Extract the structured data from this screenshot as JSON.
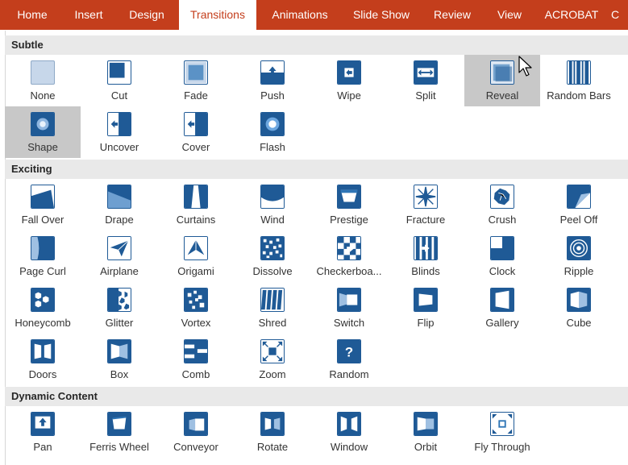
{
  "ribbon": {
    "tabs": [
      {
        "label": "Home"
      },
      {
        "label": "Insert"
      },
      {
        "label": "Design"
      },
      {
        "label": "Transitions"
      },
      {
        "label": "Animations"
      },
      {
        "label": "Slide Show"
      },
      {
        "label": "Review"
      },
      {
        "label": "View"
      },
      {
        "label": "ACROBAT"
      },
      {
        "label": "C"
      }
    ],
    "active_tab": "Transitions"
  },
  "gallery": {
    "sections": [
      {
        "title": "Subtle",
        "items": [
          {
            "label": "None",
            "icon": "none-transition-icon"
          },
          {
            "label": "Cut",
            "icon": "cut-transition-icon"
          },
          {
            "label": "Fade",
            "icon": "fade-transition-icon"
          },
          {
            "label": "Push",
            "icon": "push-transition-icon"
          },
          {
            "label": "Wipe",
            "icon": "wipe-transition-icon"
          },
          {
            "label": "Split",
            "icon": "split-transition-icon"
          },
          {
            "label": "Reveal",
            "icon": "reveal-transition-icon",
            "selected": true
          },
          {
            "label": "Random Bars",
            "icon": "random-bars-transition-icon"
          },
          {
            "label": "Shape",
            "icon": "shape-transition-icon",
            "selected": true
          },
          {
            "label": "Uncover",
            "icon": "uncover-transition-icon"
          },
          {
            "label": "Cover",
            "icon": "cover-transition-icon"
          },
          {
            "label": "Flash",
            "icon": "flash-transition-icon"
          }
        ]
      },
      {
        "title": "Exciting",
        "items": [
          {
            "label": "Fall Over",
            "icon": "fall-over-transition-icon"
          },
          {
            "label": "Drape",
            "icon": "drape-transition-icon"
          },
          {
            "label": "Curtains",
            "icon": "curtains-transition-icon"
          },
          {
            "label": "Wind",
            "icon": "wind-transition-icon"
          },
          {
            "label": "Prestige",
            "icon": "prestige-transition-icon"
          },
          {
            "label": "Fracture",
            "icon": "fracture-transition-icon"
          },
          {
            "label": "Crush",
            "icon": "crush-transition-icon"
          },
          {
            "label": "Peel Off",
            "icon": "peel-off-transition-icon"
          },
          {
            "label": "Page Curl",
            "icon": "page-curl-transition-icon"
          },
          {
            "label": "Airplane",
            "icon": "airplane-transition-icon"
          },
          {
            "label": "Origami",
            "icon": "origami-transition-icon"
          },
          {
            "label": "Dissolve",
            "icon": "dissolve-transition-icon"
          },
          {
            "label": "Checkerboa...",
            "icon": "checkerboard-transition-icon"
          },
          {
            "label": "Blinds",
            "icon": "blinds-transition-icon"
          },
          {
            "label": "Clock",
            "icon": "clock-transition-icon"
          },
          {
            "label": "Ripple",
            "icon": "ripple-transition-icon"
          },
          {
            "label": "Honeycomb",
            "icon": "honeycomb-transition-icon"
          },
          {
            "label": "Glitter",
            "icon": "glitter-transition-icon"
          },
          {
            "label": "Vortex",
            "icon": "vortex-transition-icon"
          },
          {
            "label": "Shred",
            "icon": "shred-transition-icon"
          },
          {
            "label": "Switch",
            "icon": "switch-transition-icon"
          },
          {
            "label": "Flip",
            "icon": "flip-transition-icon"
          },
          {
            "label": "Gallery",
            "icon": "gallery-transition-icon"
          },
          {
            "label": "Cube",
            "icon": "cube-transition-icon"
          },
          {
            "label": "Doors",
            "icon": "doors-transition-icon"
          },
          {
            "label": "Box",
            "icon": "box-transition-icon"
          },
          {
            "label": "Comb",
            "icon": "comb-transition-icon"
          },
          {
            "label": "Zoom",
            "icon": "zoom-transition-icon"
          },
          {
            "label": "Random",
            "icon": "random-transition-icon"
          }
        ]
      },
      {
        "title": "Dynamic Content",
        "items": [
          {
            "label": "Pan",
            "icon": "pan-transition-icon"
          },
          {
            "label": "Ferris Wheel",
            "icon": "ferris-wheel-transition-icon"
          },
          {
            "label": "Conveyor",
            "icon": "conveyor-transition-icon"
          },
          {
            "label": "Rotate",
            "icon": "rotate-transition-icon"
          },
          {
            "label": "Window",
            "icon": "window-transition-icon"
          },
          {
            "label": "Orbit",
            "icon": "orbit-transition-icon"
          },
          {
            "label": "Fly Through",
            "icon": "fly-through-transition-icon"
          }
        ]
      }
    ]
  },
  "colors": {
    "ribbon_bg": "#c43e1c",
    "icon_dark": "#1f5a96",
    "icon_mid": "#2e75b6",
    "icon_light": "#c7d7ea",
    "selected_bg": "#c8c8c8",
    "section_bg": "#e9e9e9"
  }
}
